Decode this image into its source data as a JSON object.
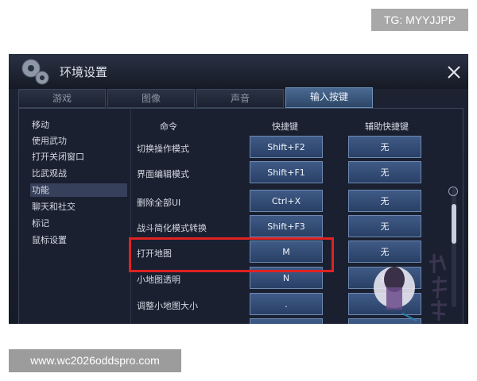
{
  "watermark": {
    "tg": "TG: MYYJJPP",
    "url": "www.wc2026oddspro.com"
  },
  "window": {
    "title": "环境设置"
  },
  "tabs": [
    {
      "label": "游戏"
    },
    {
      "label": "图像"
    },
    {
      "label": "声音"
    },
    {
      "label": "输入按键"
    }
  ],
  "sidebar": {
    "items": [
      {
        "label": "移动"
      },
      {
        "label": "使用武功"
      },
      {
        "label": "打开关闭窗口"
      },
      {
        "label": "比武观战"
      },
      {
        "label": "功能"
      },
      {
        "label": "聊天和社交"
      },
      {
        "label": "标记"
      },
      {
        "label": "鼠标设置"
      }
    ],
    "selected": "功能"
  },
  "columns": {
    "command": "命令",
    "shortcut": "快捷键",
    "alt_shortcut": "辅助快捷键"
  },
  "rows": [
    {
      "command": "切换操作模式",
      "key": "Shift+F2",
      "alt": "无"
    },
    {
      "command": "界面编辑模式",
      "key": "Shift+F1",
      "alt": "无"
    },
    {
      "command": "删除全部UI",
      "key": "Ctrl+X",
      "alt": "无"
    },
    {
      "command": "战斗简化模式转换",
      "key": "Shift+F3",
      "alt": "无"
    },
    {
      "command": "打开地图",
      "key": "M",
      "alt": "无"
    },
    {
      "command": "小地图透明",
      "key": "N",
      "alt": "无"
    },
    {
      "command": "调整小地图大小",
      "key": ".",
      "alt": ""
    },
    {
      "command": "",
      "key": "",
      "alt": ""
    }
  ],
  "highlight_row": "删除全部UI",
  "colors": {
    "highlight": "#e02222",
    "button": "#3f5b86",
    "panel": "#1a2030"
  },
  "icons": {
    "window": "gear-icon",
    "close": "close-icon"
  }
}
